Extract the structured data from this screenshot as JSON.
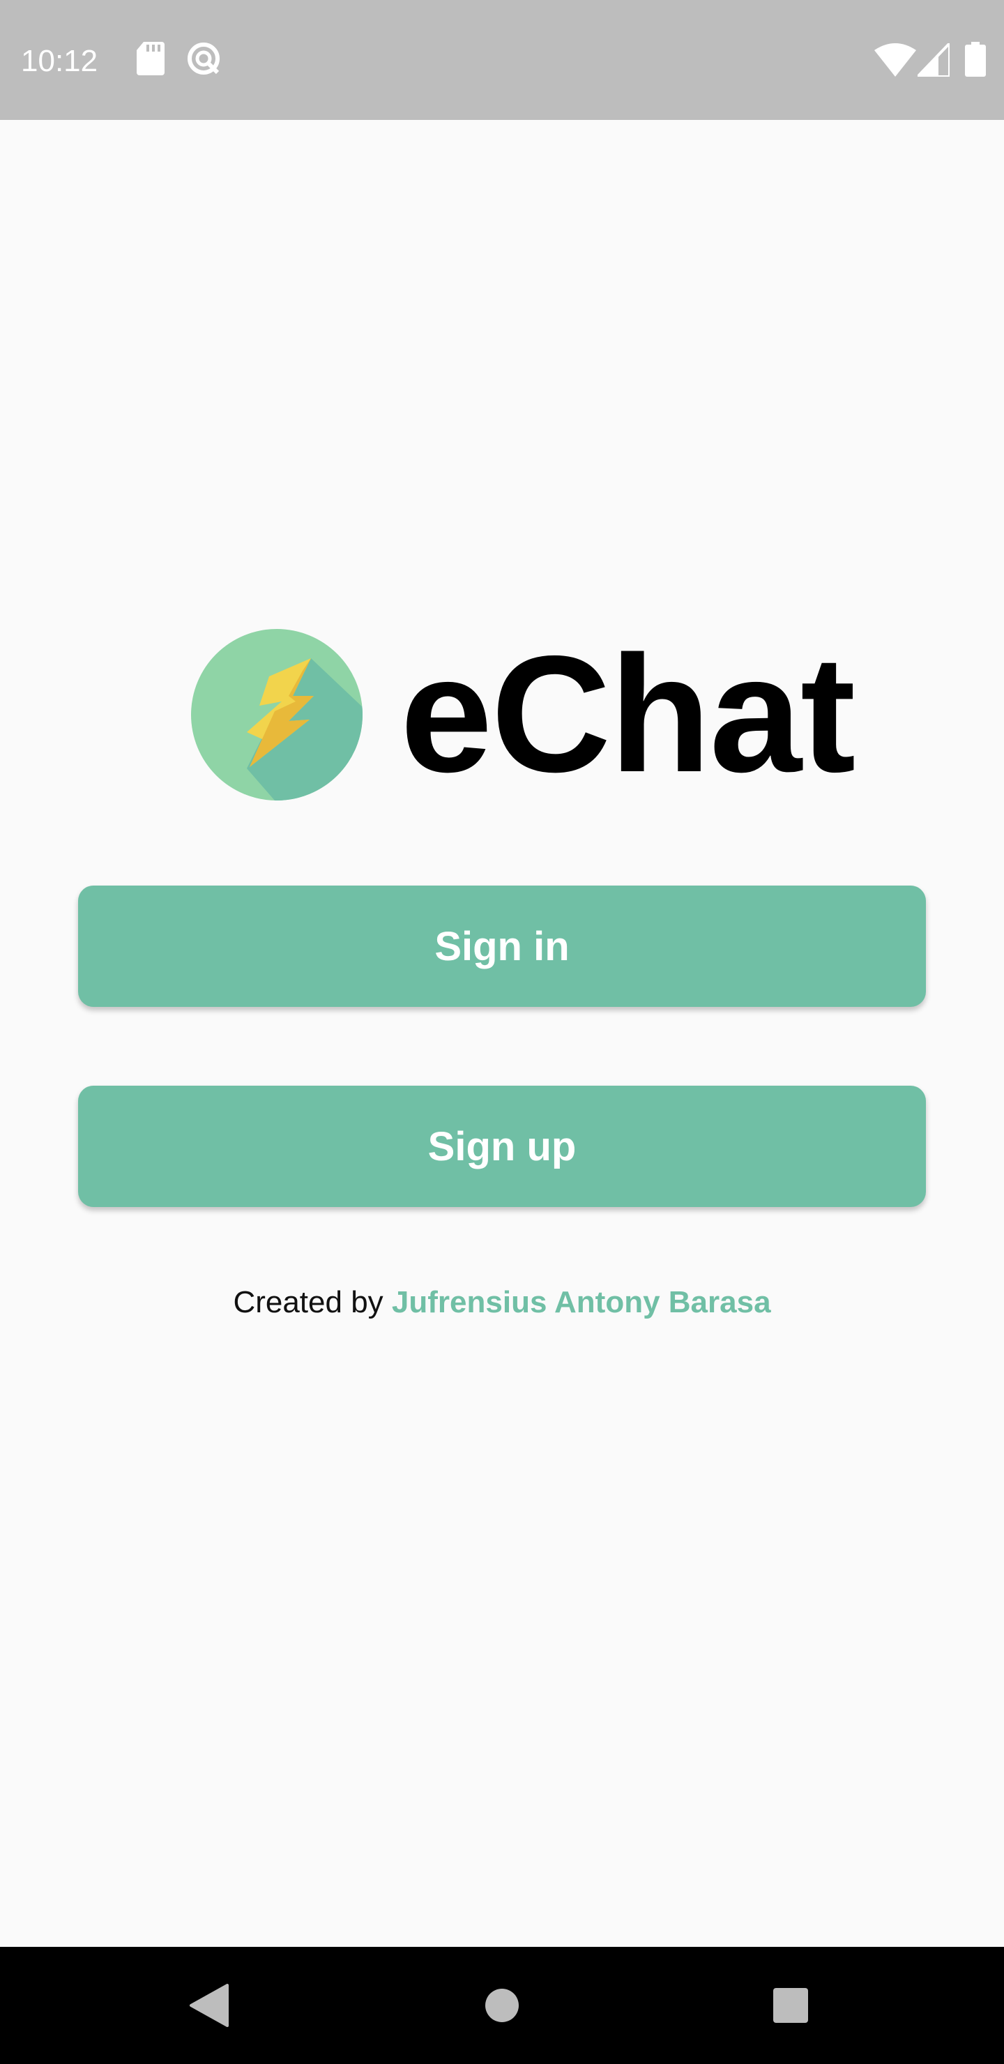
{
  "status_bar": {
    "time": "10:12",
    "icons": [
      "sd-card-icon",
      "data-saver-icon",
      "wifi-icon",
      "cell-signal-icon",
      "battery-icon"
    ]
  },
  "app": {
    "name": "eChat",
    "logo_icon": "lightning-bolt-icon"
  },
  "buttons": {
    "sign_in": "Sign in",
    "sign_up": "Sign up"
  },
  "credit": {
    "prefix": "Created by",
    "author": "Jufrensius Antony Barasa"
  },
  "nav_bar": {
    "icons": [
      "back-icon",
      "home-icon",
      "recents-icon"
    ]
  },
  "colors": {
    "accent": "#70bfa5",
    "logo_circle": "#8fd4a6",
    "status_bar": "#bdbdbd",
    "background": "#fafafa",
    "bolt_yellow": "#f2d44c",
    "bolt_dark": "#e8b93a"
  }
}
